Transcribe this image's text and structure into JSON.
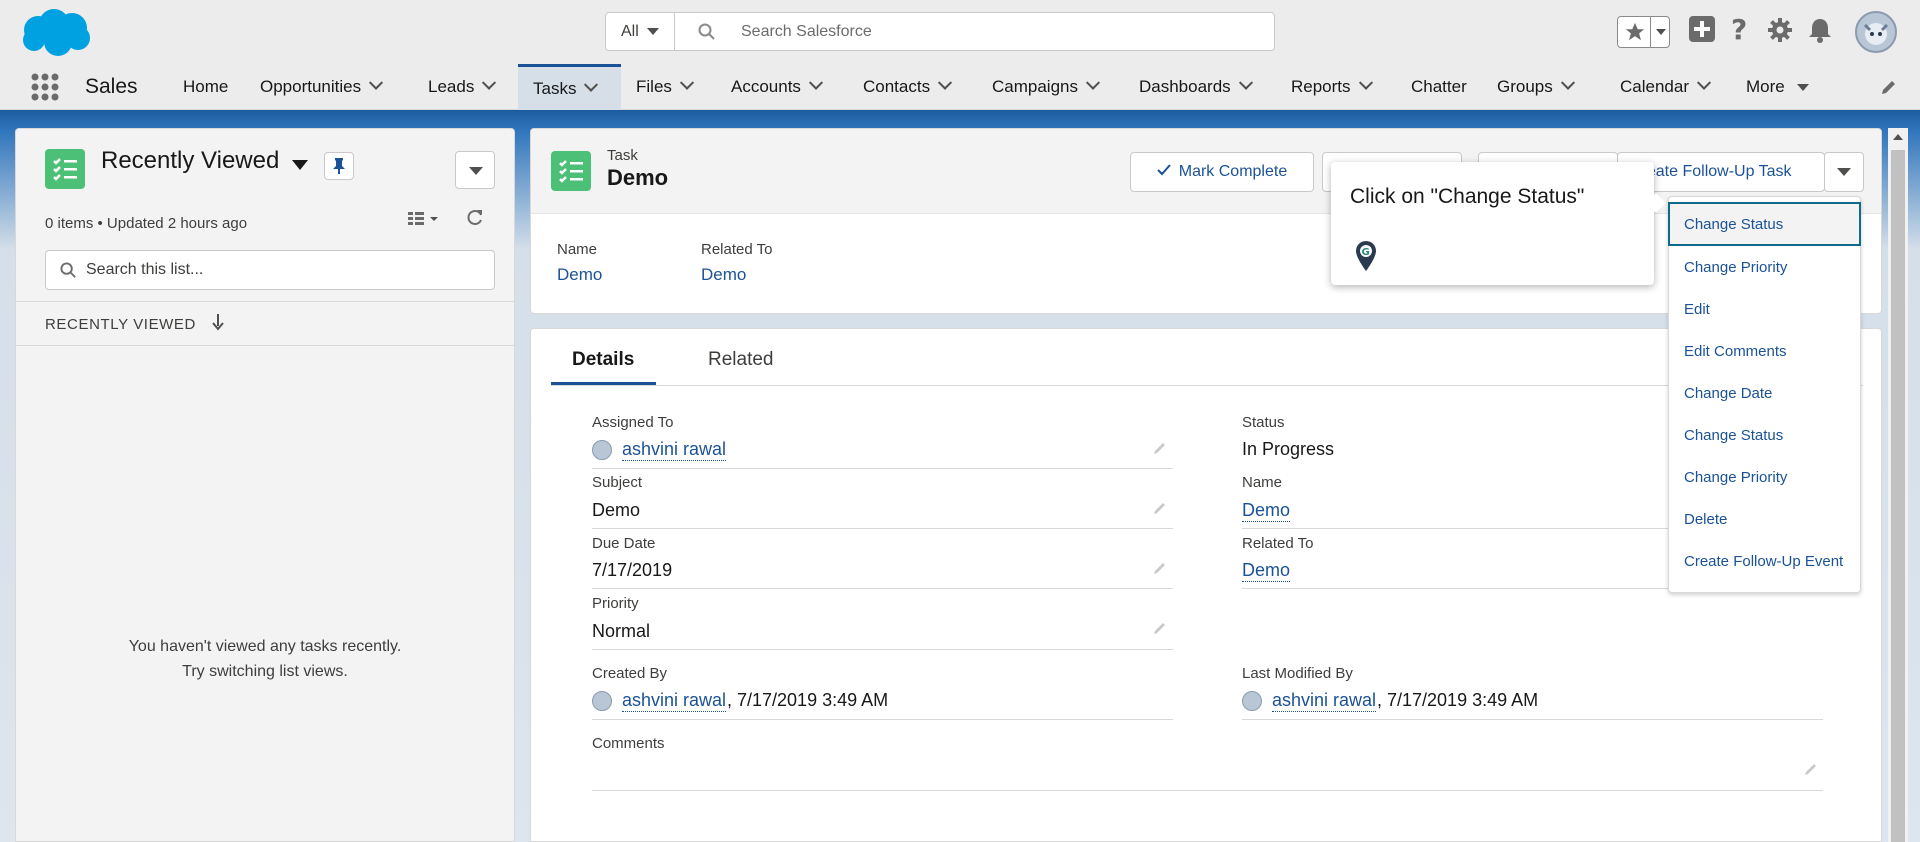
{
  "header": {
    "search_scope": "All",
    "search_placeholder": "Search Salesforce"
  },
  "nav": {
    "app_name": "Sales",
    "items": [
      {
        "label": "Home"
      },
      {
        "label": "Opportunities"
      },
      {
        "label": "Leads"
      },
      {
        "label": "Tasks"
      },
      {
        "label": "Files"
      },
      {
        "label": "Accounts"
      },
      {
        "label": "Contacts"
      },
      {
        "label": "Campaigns"
      },
      {
        "label": "Dashboards"
      },
      {
        "label": "Reports"
      },
      {
        "label": "Chatter"
      },
      {
        "label": "Groups"
      },
      {
        "label": "Calendar"
      },
      {
        "label": "More"
      }
    ],
    "active": "Tasks"
  },
  "list_view": {
    "title": "Recently Viewed",
    "meta": "0 items • Updated 2 hours ago",
    "search_placeholder": "Search this list...",
    "column_header": "RECENTLY VIEWED",
    "empty_line1": "You haven't viewed any tasks recently.",
    "empty_line2": "Try switching list views."
  },
  "record": {
    "type_label": "Task",
    "name": "Demo",
    "mark_complete_label": "Mark Complete",
    "follow_up_label": "Create Follow-Up Task",
    "highlights": {
      "name_label": "Name",
      "name_value": "Demo",
      "related_label": "Related To",
      "related_value": "Demo"
    }
  },
  "tabs": {
    "details": "Details",
    "related": "Related"
  },
  "fields": {
    "assigned_to_label": "Assigned To",
    "assigned_to_value": "ashvini rawal",
    "subject_label": "Subject",
    "subject_value": "Demo",
    "due_date_label": "Due Date",
    "due_date_value": "7/17/2019",
    "priority_label": "Priority",
    "priority_value": "Normal",
    "status_label": "Status",
    "status_value": "In Progress",
    "name_label": "Name",
    "name_value": "Demo",
    "related_to_label": "Related To",
    "related_to_value": "Demo",
    "created_by_label": "Created By",
    "created_by_user": "ashvini rawal",
    "created_by_date": ", 7/17/2019 3:49 AM",
    "modified_by_label": "Last Modified By",
    "modified_by_user": "ashvini rawal",
    "modified_by_date": ", 7/17/2019 3:49 AM",
    "comments_label": "Comments"
  },
  "menu": {
    "items": [
      "Change Status",
      "Change Priority",
      "Edit",
      "Edit Comments",
      "Change Date",
      "Change Status",
      "Change Priority",
      "Delete",
      "Create Follow-Up Event"
    ]
  },
  "guide": {
    "text": "Click on \"Change Status\""
  },
  "colors": {
    "brand_blue": "#1b5297",
    "task_green": "#4bc076",
    "salesforce_cloud": "#00a1e0"
  }
}
